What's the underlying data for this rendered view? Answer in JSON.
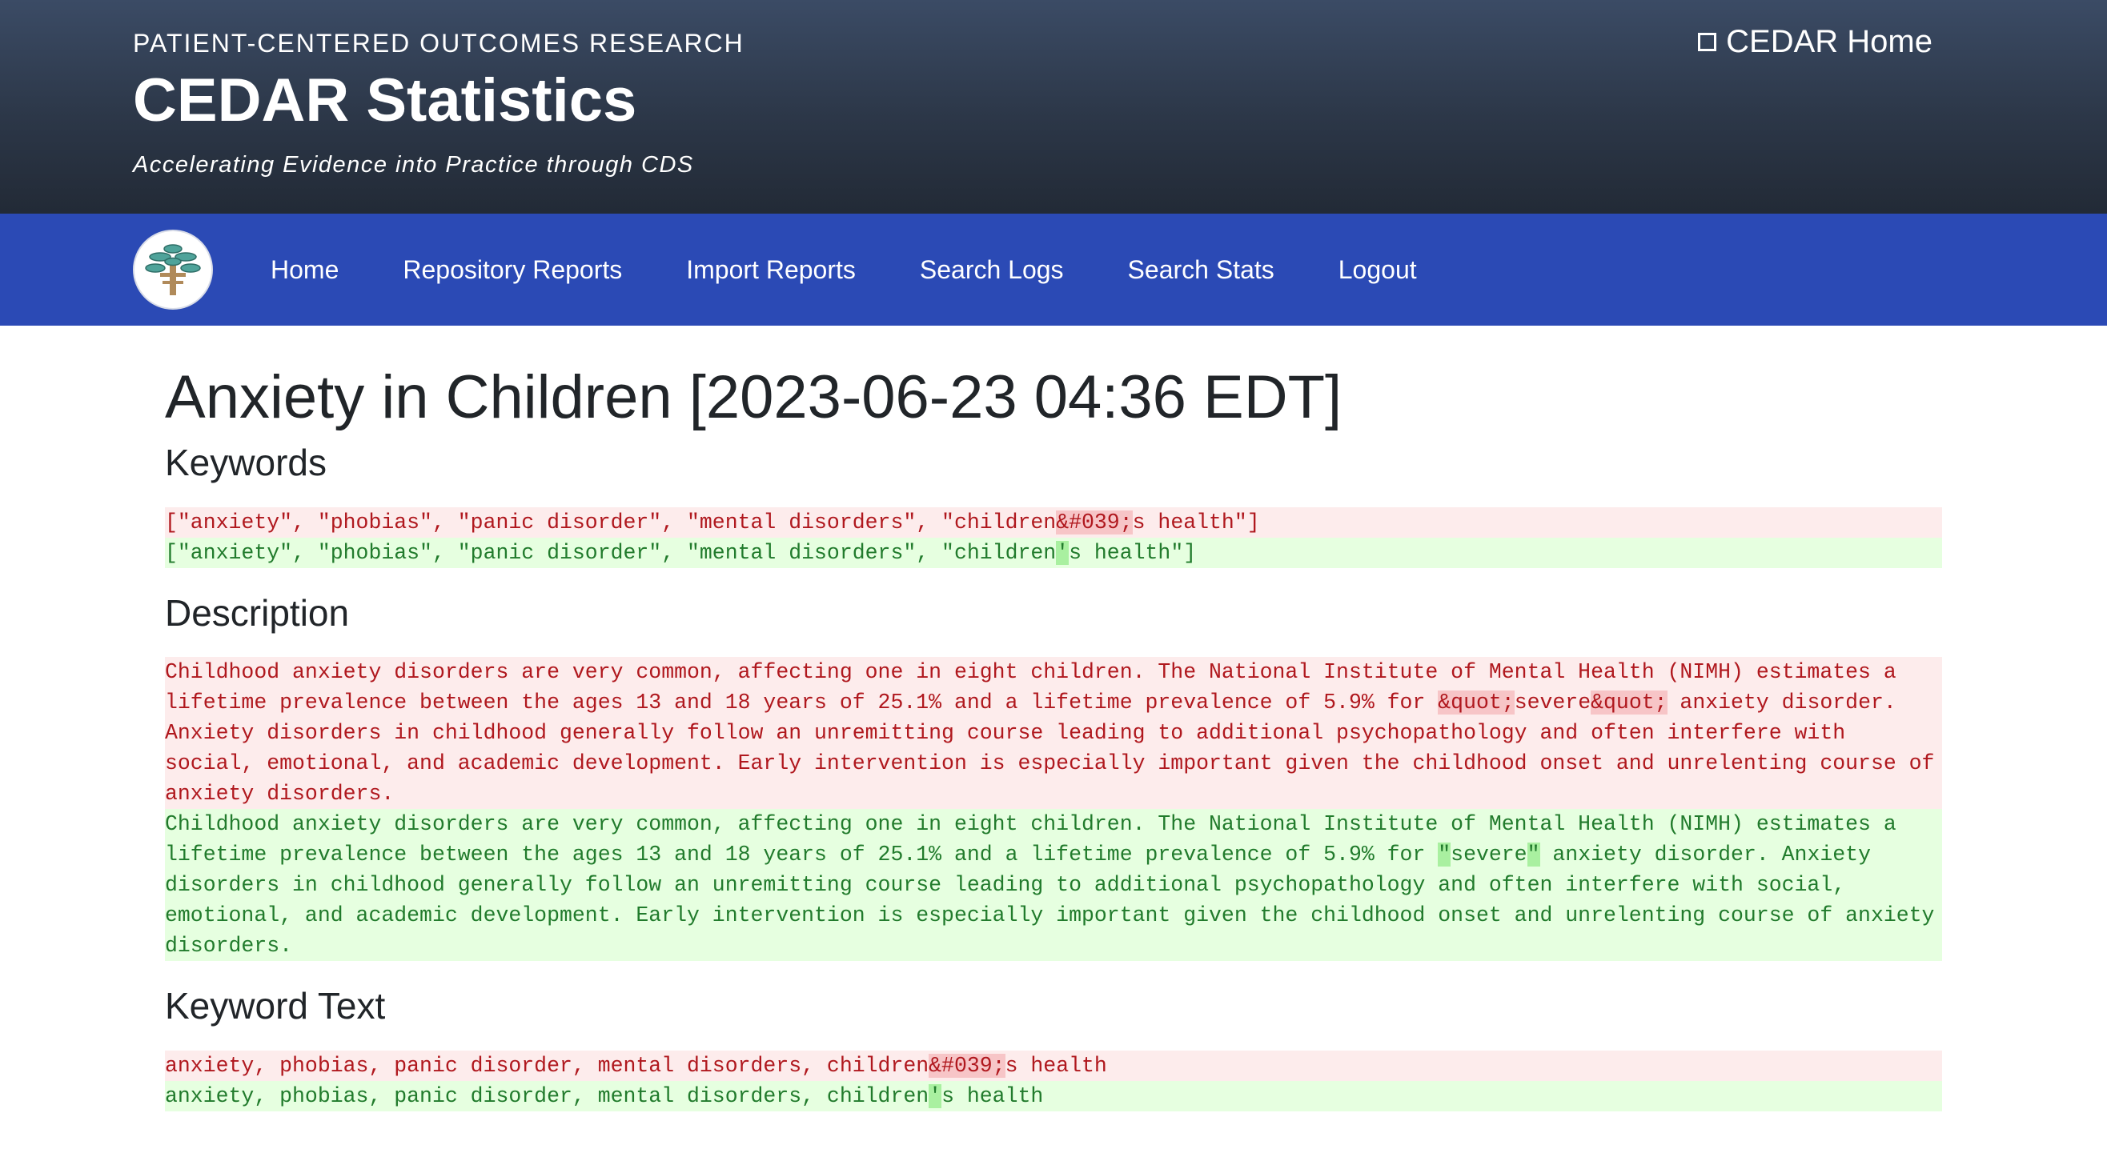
{
  "header": {
    "kicker": "PATIENT-CENTERED OUTCOMES RESEARCH",
    "title": "CEDAR Statistics",
    "tagline": "Accelerating Evidence into Practice through CDS",
    "home_link": "CEDAR Home"
  },
  "nav": {
    "items": [
      "Home",
      "Repository Reports",
      "Import Reports",
      "Search Logs",
      "Search Stats",
      "Logout"
    ]
  },
  "page": {
    "title": "Anxiety in Children [2023-06-23 04:36 EDT]"
  },
  "sections": {
    "keywords": {
      "heading": "Keywords",
      "old": {
        "pre": "[\"anxiety\", \"phobias\", \"panic disorder\", \"mental disorders\", \"children",
        "hl": "&#039;",
        "post": "s health\"]"
      },
      "new": {
        "pre": "[\"anxiety\", \"phobias\", \"panic disorder\", \"mental disorders\", \"children",
        "hl": "'",
        "post": "s health\"]"
      }
    },
    "description": {
      "heading": "Description",
      "old": {
        "p1": "Childhood anxiety disorders are very common, affecting one in eight children. The National Institute of Mental Health (NIMH) estimates a lifetime prevalence between the ages 13 and 18 years of 25.1% and a lifetime prevalence of 5.9% for ",
        "hl1": "&quot;",
        "mid": "severe",
        "hl2": "&quot;",
        "p2": " anxiety disorder. Anxiety disorders in childhood generally follow an unremitting course leading to additional psychopathology and often interfere with social, emotional, and academic development. Early intervention is especially important given the childhood onset and unrelenting course of anxiety disorders."
      },
      "new": {
        "p1": "Childhood anxiety disorders are very common, affecting one in eight children. The National Institute of Mental Health (NIMH) estimates a lifetime prevalence between the ages 13 and 18 years of 25.1% and a lifetime prevalence of 5.9% for ",
        "hl1": "\"",
        "mid": "severe",
        "hl2": "\"",
        "p2": " anxiety disorder. Anxiety disorders in childhood generally follow an unremitting course leading to additional psychopathology and often interfere with social, emotional, and academic development. Early intervention is especially important given the childhood onset and unrelenting course of anxiety disorders."
      }
    },
    "keyword_text": {
      "heading": "Keyword Text",
      "old": {
        "pre": "anxiety, phobias, panic disorder, mental disorders, children",
        "hl": "&#039;",
        "post": "s health"
      },
      "new": {
        "pre": "anxiety, phobias, panic disorder, mental disorders, children",
        "hl": "'",
        "post": "s health"
      }
    }
  },
  "colors": {
    "header_top": "#3b4b65",
    "navbar": "#2b4ab5",
    "diff_del_bg": "#fdecec",
    "diff_del_text": "#b0181e",
    "diff_ins_bg": "#e6ffe0",
    "diff_ins_text": "#217b2c"
  },
  "icons": {
    "home_link": "square-icon",
    "logo": "tree-logo-icon"
  }
}
